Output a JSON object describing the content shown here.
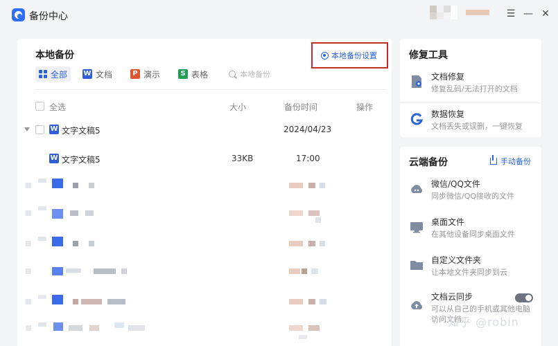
{
  "app": {
    "title": "备份中心"
  },
  "local_backup": {
    "title": "本地备份",
    "settings_label": "本地备份设置",
    "filters": [
      {
        "label": "全部",
        "icon": "grid-icon"
      },
      {
        "label": "文档",
        "icon": "W",
        "color": "#2f5ed9"
      },
      {
        "label": "演示",
        "icon": "P",
        "color": "#e0552f"
      },
      {
        "label": "表格",
        "icon": "S",
        "color": "#1f9d55"
      }
    ],
    "search_placeholder": "本地备份",
    "columns": {
      "select_all": "全选",
      "size": "大小",
      "time": "备份时间",
      "action": "操作"
    },
    "group": {
      "name": "文字文稿5",
      "date": "2024/04/23"
    },
    "item": {
      "name": "文字文稿5",
      "size": "33KB",
      "time": "17:00"
    }
  },
  "repair_tools": {
    "title": "修复工具",
    "items": [
      {
        "name": "文档修复",
        "desc": "修复乱码/无法打开的文档"
      },
      {
        "name": "数据恢复",
        "desc": "文档丢失或误删，一键恢复"
      }
    ]
  },
  "cloud_backup": {
    "title": "云端备份",
    "manual_label": "手动备份",
    "items": [
      {
        "name": "微信/QQ文件",
        "desc": "同步微信/QQ接收的文件"
      },
      {
        "name": "桌面文件",
        "desc": "在其他设备同步桌面文件"
      },
      {
        "name": "自定义文件夹",
        "desc": "让本地文件夹同步到云"
      },
      {
        "name": "文档云同步",
        "desc": "可以从自己的手机或其他电脑",
        "desc2": "访问文档..."
      }
    ]
  },
  "watermark": "知乎 @robin"
}
